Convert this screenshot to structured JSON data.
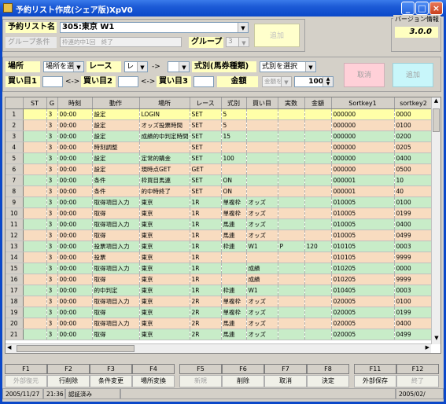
{
  "window": {
    "title": "予約リスト作成(シェア版)XpV0"
  },
  "version": {
    "label": "バージョン情報",
    "value": "3.0.0"
  },
  "list_name": {
    "label": "予約リスト名",
    "value": "305:東京 W1"
  },
  "group_condition_label": "グループ条件",
  "group_condition_value": "枠連的中1回　終了",
  "group": {
    "label": "グループ",
    "value": "3"
  },
  "add_button_top": "追加",
  "filters": {
    "place_label": "場所",
    "place_select": "場所を選",
    "race_label": "レース",
    "race_select": "レ",
    "arrow": "->",
    "formula_label": "式別(馬券種類)",
    "formula_select": "式別を選択",
    "buy1_label": "買い目1",
    "buy2_label": "買い目2",
    "buy3_label": "買い目3",
    "range_arrow": "<->",
    "amount_label": "金額",
    "amount_type": "金額を",
    "amount_value": "100",
    "cancel_button": "取消",
    "add_button": "追加"
  },
  "table": {
    "headers": [
      "ST",
      "G",
      "時刻",
      "動作",
      "場所",
      "レース",
      "式別",
      "買い目",
      "実数",
      "金額",
      "Sortkey1",
      "sortkey2"
    ],
    "rows": [
      [
        "1",
        "",
        "3",
        "00:00",
        "設定",
        "LOGIN",
        "SET",
        "5",
        "",
        "",
        "",
        "000000",
        "0000"
      ],
      [
        "2",
        "",
        "3",
        "00:00",
        "設定",
        "オッズ投票時間",
        "SET",
        "5",
        "",
        "",
        "",
        "000000",
        "0100"
      ],
      [
        "3",
        "",
        "3",
        "00:00",
        "設定",
        "成績的中判定時間",
        "SET",
        "15",
        "",
        "",
        "",
        "000000",
        "0200"
      ],
      [
        "4",
        "",
        "3",
        "00:00",
        "時刻調整",
        "",
        "SET",
        "",
        "",
        "",
        "",
        "000000",
        "0205"
      ],
      [
        "5",
        "",
        "3",
        "00:00",
        "設定",
        "定常的購金",
        "SET",
        "100",
        "",
        "",
        "",
        "000000",
        "0400"
      ],
      [
        "6",
        "",
        "3",
        "00:00",
        "設定",
        "現時点GET",
        "GET",
        "",
        "",
        "",
        "",
        "000000",
        "0500"
      ],
      [
        "7",
        "",
        "3",
        "00:00",
        "条件",
        "枠買目馬連",
        "SET",
        "ON",
        "",
        "",
        "",
        "000001",
        "10"
      ],
      [
        "8",
        "",
        "3",
        "00:00",
        "条件",
        "的中時終了",
        "SET",
        "ON",
        "",
        "",
        "",
        "000001",
        "40"
      ],
      [
        "9",
        "",
        "3",
        "00:00",
        "取得項目入力",
        "東京",
        "1R",
        "単複枠",
        "オッズ",
        "",
        "",
        "010005",
        "0100"
      ],
      [
        "10",
        "",
        "3",
        "00:00",
        "取得",
        "東京",
        "1R",
        "単複枠",
        "オッズ",
        "",
        "",
        "010005",
        "0199"
      ],
      [
        "11",
        "",
        "3",
        "00:00",
        "取得項目入力",
        "東京",
        "1R",
        "馬連",
        "オッズ",
        "",
        "",
        "010005",
        "0400"
      ],
      [
        "12",
        "",
        "3",
        "00:00",
        "取得",
        "東京",
        "1R",
        "馬連",
        "オッズ",
        "",
        "",
        "010005",
        "0499"
      ],
      [
        "13",
        "",
        "3",
        "00:00",
        "投票項目入力",
        "東京",
        "1R",
        "枠連",
        "W1",
        "P",
        "120",
        "010105",
        "0003"
      ],
      [
        "14",
        "",
        "3",
        "00:00",
        "投票",
        "東京",
        "1R",
        "",
        "",
        "",
        "",
        "010105",
        "9999"
      ],
      [
        "15",
        "",
        "3",
        "00:00",
        "取得項目入力",
        "東京",
        "1R",
        "",
        "成績",
        "",
        "",
        "010205",
        "0000"
      ],
      [
        "16",
        "",
        "3",
        "00:00",
        "取得",
        "東京",
        "1R",
        "",
        "成績",
        "",
        "",
        "010205",
        "9999"
      ],
      [
        "17",
        "",
        "3",
        "00:00",
        "的中判定",
        "東京",
        "1R",
        "枠連",
        "W1",
        "",
        "",
        "010405",
        "0003"
      ],
      [
        "18",
        "",
        "3",
        "00:00",
        "取得項目入力",
        "東京",
        "2R",
        "単複枠",
        "オッズ",
        "",
        "",
        "020005",
        "0100"
      ],
      [
        "19",
        "",
        "3",
        "00:00",
        "取得",
        "東京",
        "2R",
        "単複枠",
        "オッズ",
        "",
        "",
        "020005",
        "0199"
      ],
      [
        "20",
        "",
        "3",
        "00:00",
        "取得項目入力",
        "東京",
        "2R",
        "馬連",
        "オッズ",
        "",
        "",
        "020005",
        "0400"
      ],
      [
        "21",
        "",
        "3",
        "00:00",
        "取得",
        "東京",
        "2R",
        "馬連",
        "オッズ",
        "",
        "",
        "020005",
        "0499"
      ]
    ]
  },
  "fkeys": [
    {
      "key": "F1",
      "label": "外部復元",
      "enabled": false
    },
    {
      "key": "F2",
      "label": "行削除",
      "enabled": true
    },
    {
      "key": "F3",
      "label": "条件変更",
      "enabled": true
    },
    {
      "key": "F4",
      "label": "場所変換",
      "enabled": true
    },
    {
      "key": "F5",
      "label": "新規",
      "enabled": false
    },
    {
      "key": "F6",
      "label": "削除",
      "enabled": true
    },
    {
      "key": "F7",
      "label": "取消",
      "enabled": true
    },
    {
      "key": "F8",
      "label": "決定",
      "enabled": true
    },
    {
      "key": "F11",
      "label": "外部保存",
      "enabled": true
    },
    {
      "key": "F12",
      "label": "終了",
      "enabled": false
    }
  ],
  "status": {
    "date": "2005/11/27",
    "time": "21:36",
    "auth": "認証済み",
    "right": "2005/02/"
  },
  "colors": {
    "titlebar": "#0b48c9",
    "row_odd": "#f8dcc0",
    "row_even": "#c8ecc8",
    "row_selected": "#ffffa8"
  }
}
